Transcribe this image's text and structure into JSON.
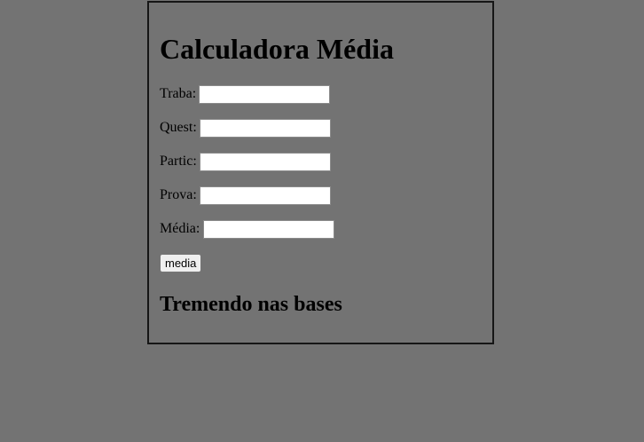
{
  "calculator": {
    "title": "Calculadora Média",
    "fields": [
      {
        "label": "Traba:",
        "value": ""
      },
      {
        "label": "Quest:",
        "value": ""
      },
      {
        "label": "Partic:",
        "value": ""
      },
      {
        "label": "Prova:",
        "value": ""
      },
      {
        "label": "Média:",
        "value": ""
      }
    ],
    "button_label": "media",
    "result_text": "Tremendo nas bases"
  },
  "colors": {
    "background": "#737373",
    "border": "#161616",
    "input_background": "#ffffff",
    "button_background": "#efefef"
  }
}
